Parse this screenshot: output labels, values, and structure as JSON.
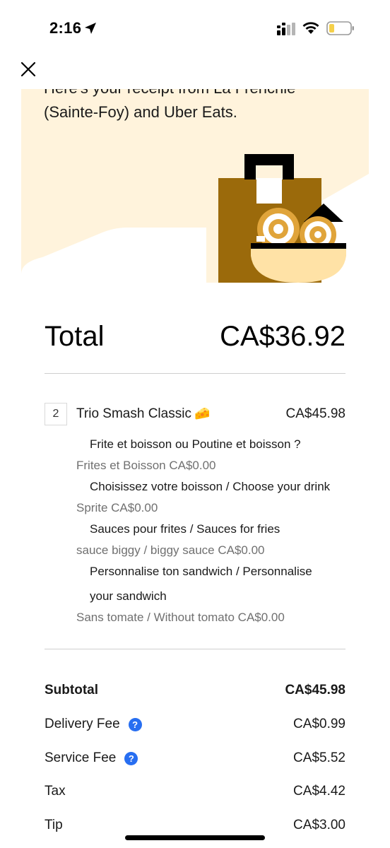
{
  "status_bar": {
    "time": "2:16",
    "icons": [
      "location-arrow-icon",
      "signal-icon",
      "wifi-icon",
      "battery-icon"
    ],
    "battery_color": "#f5d04a"
  },
  "header": {
    "close_icon": "close-icon"
  },
  "hero": {
    "text": "Here's your receipt from La Frenchie (Sainte-Foy) and Uber Eats.",
    "background": "#fff3dc",
    "illustration": "bag-and-noodle-bowl-illustration",
    "colors": {
      "bag": "#9b6a0b",
      "bowl": "#ffe2a6",
      "noodle": "#e0a43a"
    }
  },
  "total": {
    "label": "Total",
    "value": "CA$36.92"
  },
  "order_item": {
    "quantity": "2",
    "name": "Trio Smash Classic",
    "emoji": "🧀",
    "price": "CA$45.98",
    "options": [
      {
        "heading": "Frite et boisson ou Poutine et boisson ?",
        "value": "Frites et Boisson CA$0.00"
      },
      {
        "heading": "Choisissez votre boisson / Choose your drink",
        "value": "Sprite CA$0.00"
      },
      {
        "heading": "Sauces pour frites / Sauces for fries",
        "value": "sauce biggy / biggy sauce CA$0.00"
      },
      {
        "heading_line1": "Personnalise ton sandwich / Personnalise",
        "heading_line2": "your sandwich",
        "value": "Sans tomate / Without tomato CA$0.00"
      }
    ]
  },
  "summary": {
    "subtotal": {
      "label": "Subtotal",
      "value": "CA$45.98"
    },
    "delivery_fee": {
      "label": "Delivery Fee",
      "value": "CA$0.99"
    },
    "service_fee": {
      "label": "Service Fee",
      "value": "CA$5.52"
    },
    "tax": {
      "label": "Tax",
      "value": "CA$4.42"
    },
    "tip": {
      "label": "Tip",
      "value": "CA$3.00"
    },
    "help_icon_color": "#276ef1"
  }
}
